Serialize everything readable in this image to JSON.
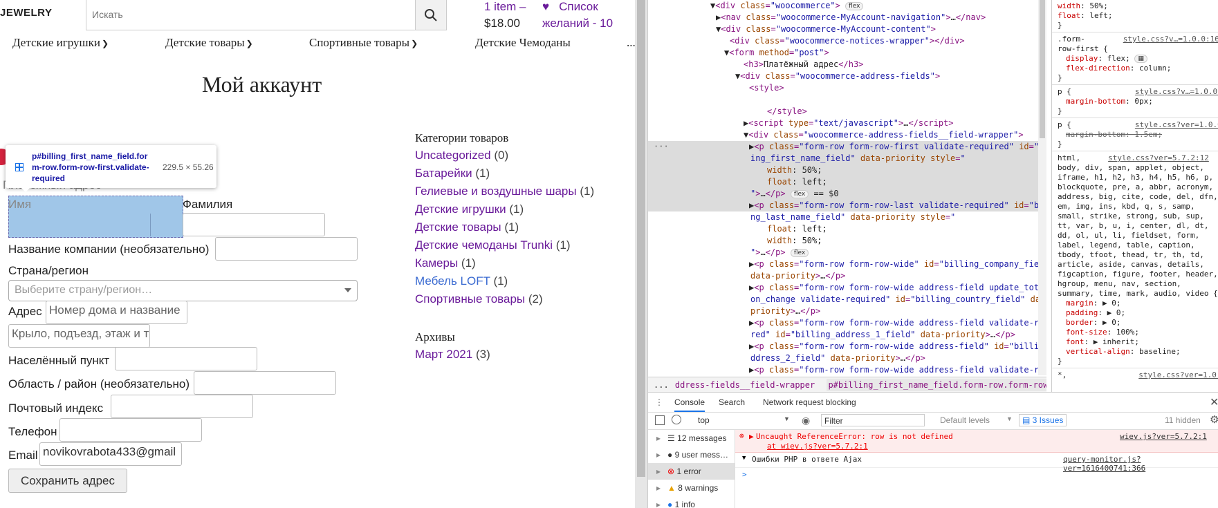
{
  "site": {
    "logo": "JEWELRY",
    "search_placeholder": "Искать",
    "cart_items": "1 item –",
    "cart_total": "$18.00",
    "wishlist_line1": "Список",
    "wishlist_line2": "желаний - 10",
    "nav": [
      "Детские игрушки",
      "Детские товары",
      "Спортивные товары",
      "Детские Чемоданы"
    ],
    "nav_more": "..."
  },
  "page": {
    "title": "Мой аккаунт",
    "section_heading_partial": "Платёжный адрес",
    "form": {
      "first_name_label": "Имя",
      "last_name_label": "Фамилия",
      "company_label": "Название компании (необязательно)",
      "country_label": "Страна/регион",
      "country_placeholder": "Выберите страну/регион…",
      "address_label": "Адрес",
      "address1_placeholder": "Номер дома и название",
      "address2_placeholder": "Крыло, подъезд, этаж и т",
      "city_label": "Населённый пункт",
      "state_label": "Область / район (необязательно)",
      "postcode_label": "Почтовый индекс",
      "phone_label": "Телефон",
      "email_label": "Email",
      "email_value": "novikovrabota433@gmail",
      "save_label": "Сохранить адрес"
    },
    "sidebar": {
      "categories_title": "Категории товаров",
      "categories": [
        {
          "name": "Uncategorized",
          "count": "(0)"
        },
        {
          "name": "Батарейки",
          "count": "(1)"
        },
        {
          "name": "Гелиевые и воздушные шары",
          "count": "(1)"
        },
        {
          "name": "Детские игрушки",
          "count": "(1)"
        },
        {
          "name": "Детские товары",
          "count": "(1)"
        },
        {
          "name": "Детские чемоданы Trunki",
          "count": "(1)"
        },
        {
          "name": "Камеры",
          "count": "(1)"
        },
        {
          "name": "Мебель LOFT",
          "count": "(1)"
        },
        {
          "name": "Спортивные товары",
          "count": "(2)"
        }
      ],
      "archives_title": "Архивы",
      "archives": [
        {
          "name": "Март 2021",
          "count": "(3)"
        }
      ]
    }
  },
  "inspector_tooltip": {
    "selector": "p#billing_first_name_field.form-row.form-row-first.validate-required",
    "size": "229.5 × 55.26"
  },
  "devtools": {
    "breadcrumbs": [
      "...",
      "ddress-fields__field-wrapper",
      "p#billing_first_name_field.form-row.form-row-first.validate-required",
      "..."
    ],
    "console_tabs": [
      "Console",
      "Search",
      "Network request blocking"
    ],
    "context": "top",
    "filter_placeholder": "Filter",
    "levels": "Default levels",
    "issues": "3 Issues",
    "hidden": "11 hidden",
    "sidebar": [
      {
        "label": "12 messages"
      },
      {
        "label": "9 user mess…"
      },
      {
        "label": "1 error"
      },
      {
        "label": "8 warnings"
      },
      {
        "label": "1 info"
      }
    ],
    "error_text": "Uncaught ReferenceError: row is not defined",
    "error_at": "at wiev.js?ver=5.7.2:1",
    "error_link": "wiev.js?ver=5.7.2:1",
    "group_text": "Ошибки PHP  в ответе Ajax",
    "group_link": "query-monitor.js?ver=1616400741:366",
    "prompt": ">"
  },
  "colors": {
    "link_purple": "#6a1b9a",
    "highlight": "#6fa8dc",
    "error_red": "#e00000"
  }
}
